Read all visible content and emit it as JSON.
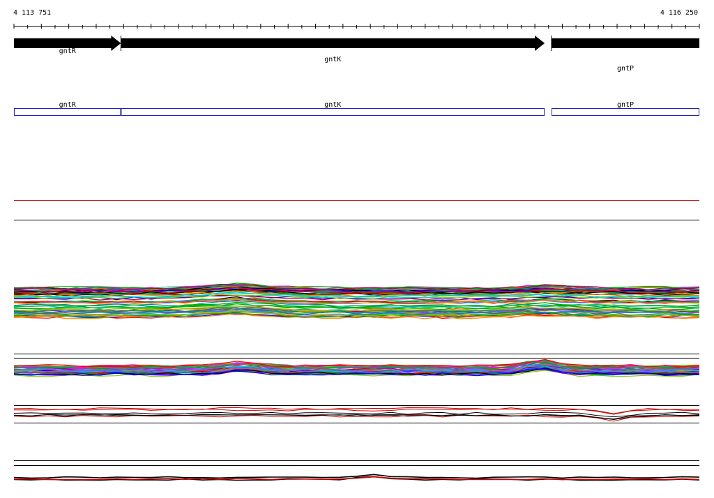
{
  "ruler": {
    "start_label": "4 113 751",
    "end_label": "4 116 250",
    "start": 4113751,
    "end": 4116250
  },
  "genes": [
    {
      "name": "gntR",
      "start": 4113751,
      "end": 4114141,
      "strand": "+"
    },
    {
      "name": "gntK",
      "start": 4114141,
      "end": 4115686,
      "strand": "+"
    },
    {
      "name": "gntP",
      "start": 4115711,
      "end": 4116250,
      "strand": "+"
    }
  ],
  "cds": [
    {
      "name": "gntR",
      "start": 4113751,
      "end": 4114141
    },
    {
      "name": "gntK",
      "start": 4114141,
      "end": 4115686
    },
    {
      "name": "gntP",
      "start": 4115711,
      "end": 4116250
    }
  ],
  "colors": {
    "gene_fill": "#000000",
    "cds_stroke": "#1f1fbf",
    "marker_line": "#cc2020",
    "separator": "#000000",
    "track_palette": [
      "#ff0000",
      "#00aa00",
      "#0000ff",
      "#ff00ff",
      "#00cccc",
      "#cc8800",
      "#8800cc",
      "#008888",
      "#88cc00",
      "#000000",
      "#ff8800",
      "#6666ff",
      "#aa0044",
      "#22aa66",
      "#996633"
    ]
  },
  "tracks": [
    {
      "id": "profiles-large",
      "line_count": 60
    },
    {
      "id": "profiles-medium",
      "line_count": 40
    },
    {
      "id": "profiles-small",
      "line_count": 6
    },
    {
      "id": "profiles-bottom",
      "line_count": 3
    }
  ]
}
